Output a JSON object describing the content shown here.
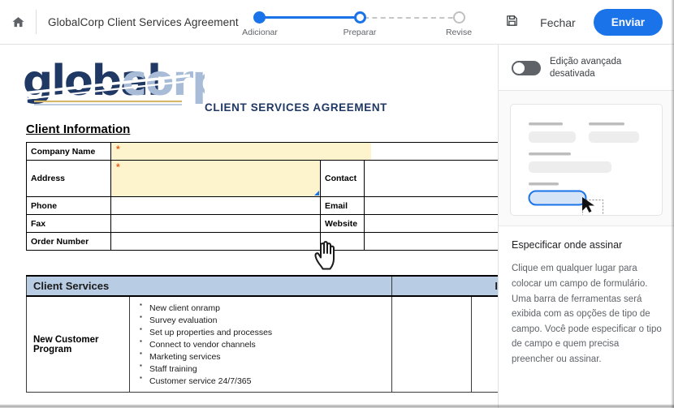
{
  "topbar": {
    "home_icon": "home-icon",
    "doc_title": "GlobalCorp Client Services Agreement",
    "save_icon": "save-floppy-icon",
    "close_label": "Fechar",
    "send_label": "Enviar",
    "accent_color": "#1a73e8"
  },
  "stepper": {
    "steps": [
      {
        "label": "Adicionar",
        "state": "done"
      },
      {
        "label": "Preparar",
        "state": "current"
      },
      {
        "label": "Revise",
        "state": "todo"
      }
    ]
  },
  "document": {
    "logo": {
      "text_dark": "global",
      "text_light": "corp",
      "dark_color": "#1f3864",
      "light_color": "#a8bcd8"
    },
    "tagline": "CLIENT SERVICES AGREEMENT",
    "client_information": {
      "section_title": "Client Information",
      "rows": [
        {
          "label": "Company Name",
          "field": "required-yellow-short",
          "label2": "",
          "field2": ""
        },
        {
          "label": "Address",
          "field": "required-yellow-tall",
          "label2": "Contact",
          "field2": ""
        },
        {
          "label": "Phone",
          "field": "",
          "label2": "Email",
          "field2": ""
        },
        {
          "label": "Fax",
          "field": "",
          "label2": "Website",
          "field2": ""
        },
        {
          "label": "Order Number",
          "field": "",
          "label2": "",
          "field2": ""
        }
      ],
      "required_marker": "*",
      "field_fill_color": "#fdf3cd",
      "required_marker_color": "#e8601c"
    },
    "client_services": {
      "header_left": "Client Services",
      "header_right": "Investment",
      "header_color": "#b8cce4",
      "program_name": "New Customer Program",
      "items": [
        "New client onramp",
        "Survey evaluation",
        "Set up properties and processes",
        "Connect to vendor channels",
        "Marketing services",
        "Staff training",
        "Customer service 24/7/365"
      ]
    }
  },
  "sidebar": {
    "toggle": {
      "label": "Edição avançada desativada",
      "state": "off"
    },
    "illustration": {
      "name": "form-field-placement-illustration"
    },
    "help_title": "Especificar onde assinar",
    "help_body": "Clique em qualquer lugar para colocar um campo de formulário. Uma barra de ferramentas será exibida com as opções de tipo de campo. Você pode especificar o tipo de campo e quem precisa preencher ou assinar."
  },
  "cursor": {
    "type": "pointing-hand-cursor"
  }
}
